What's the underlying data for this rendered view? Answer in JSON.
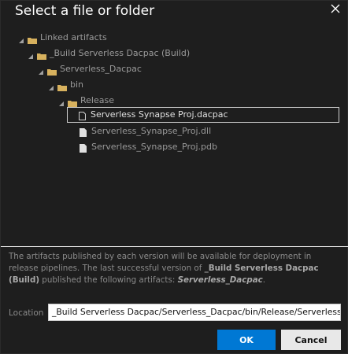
{
  "dialog": {
    "title": "Select a file or folder",
    "close_icon": "close-icon"
  },
  "tree": {
    "items": [
      {
        "label": "Linked artifacts",
        "type": "folder",
        "expanded": true
      },
      {
        "label": "_Build Serverless Dacpac (Build)",
        "type": "folder",
        "expanded": true
      },
      {
        "label": "Serverless_Dacpac",
        "type": "folder",
        "expanded": true
      },
      {
        "label": "bin",
        "type": "folder",
        "expanded": true
      },
      {
        "label": "Release",
        "type": "folder",
        "expanded": true
      },
      {
        "label": "Serverless Synapse Proj.dacpac",
        "type": "file",
        "selected": true
      },
      {
        "label": "Serverless_Synapse_Proj.dll",
        "type": "file"
      },
      {
        "label": "Serverless_Synapse_Proj.pdb",
        "type": "file"
      }
    ]
  },
  "info": {
    "text_1": "The artifacts published by each version will be available for deployment in release pipelines. The last successful version of ",
    "build_name": "_Build Serverless Dacpac (Build)",
    "text_2": " published the following artifacts: ",
    "artifact_name": "Serverless_Dacpac",
    "text_3": "."
  },
  "location": {
    "label": "Location",
    "value": "_Build Serverless Dacpac/Serverless_Dacpac/bin/Release/Serverless Syn"
  },
  "buttons": {
    "ok_label": "OK",
    "cancel_label": "Cancel"
  },
  "colors": {
    "ok_background": "#0078d4",
    "folder": "#d7b15e",
    "background": "#1e1e1e"
  }
}
